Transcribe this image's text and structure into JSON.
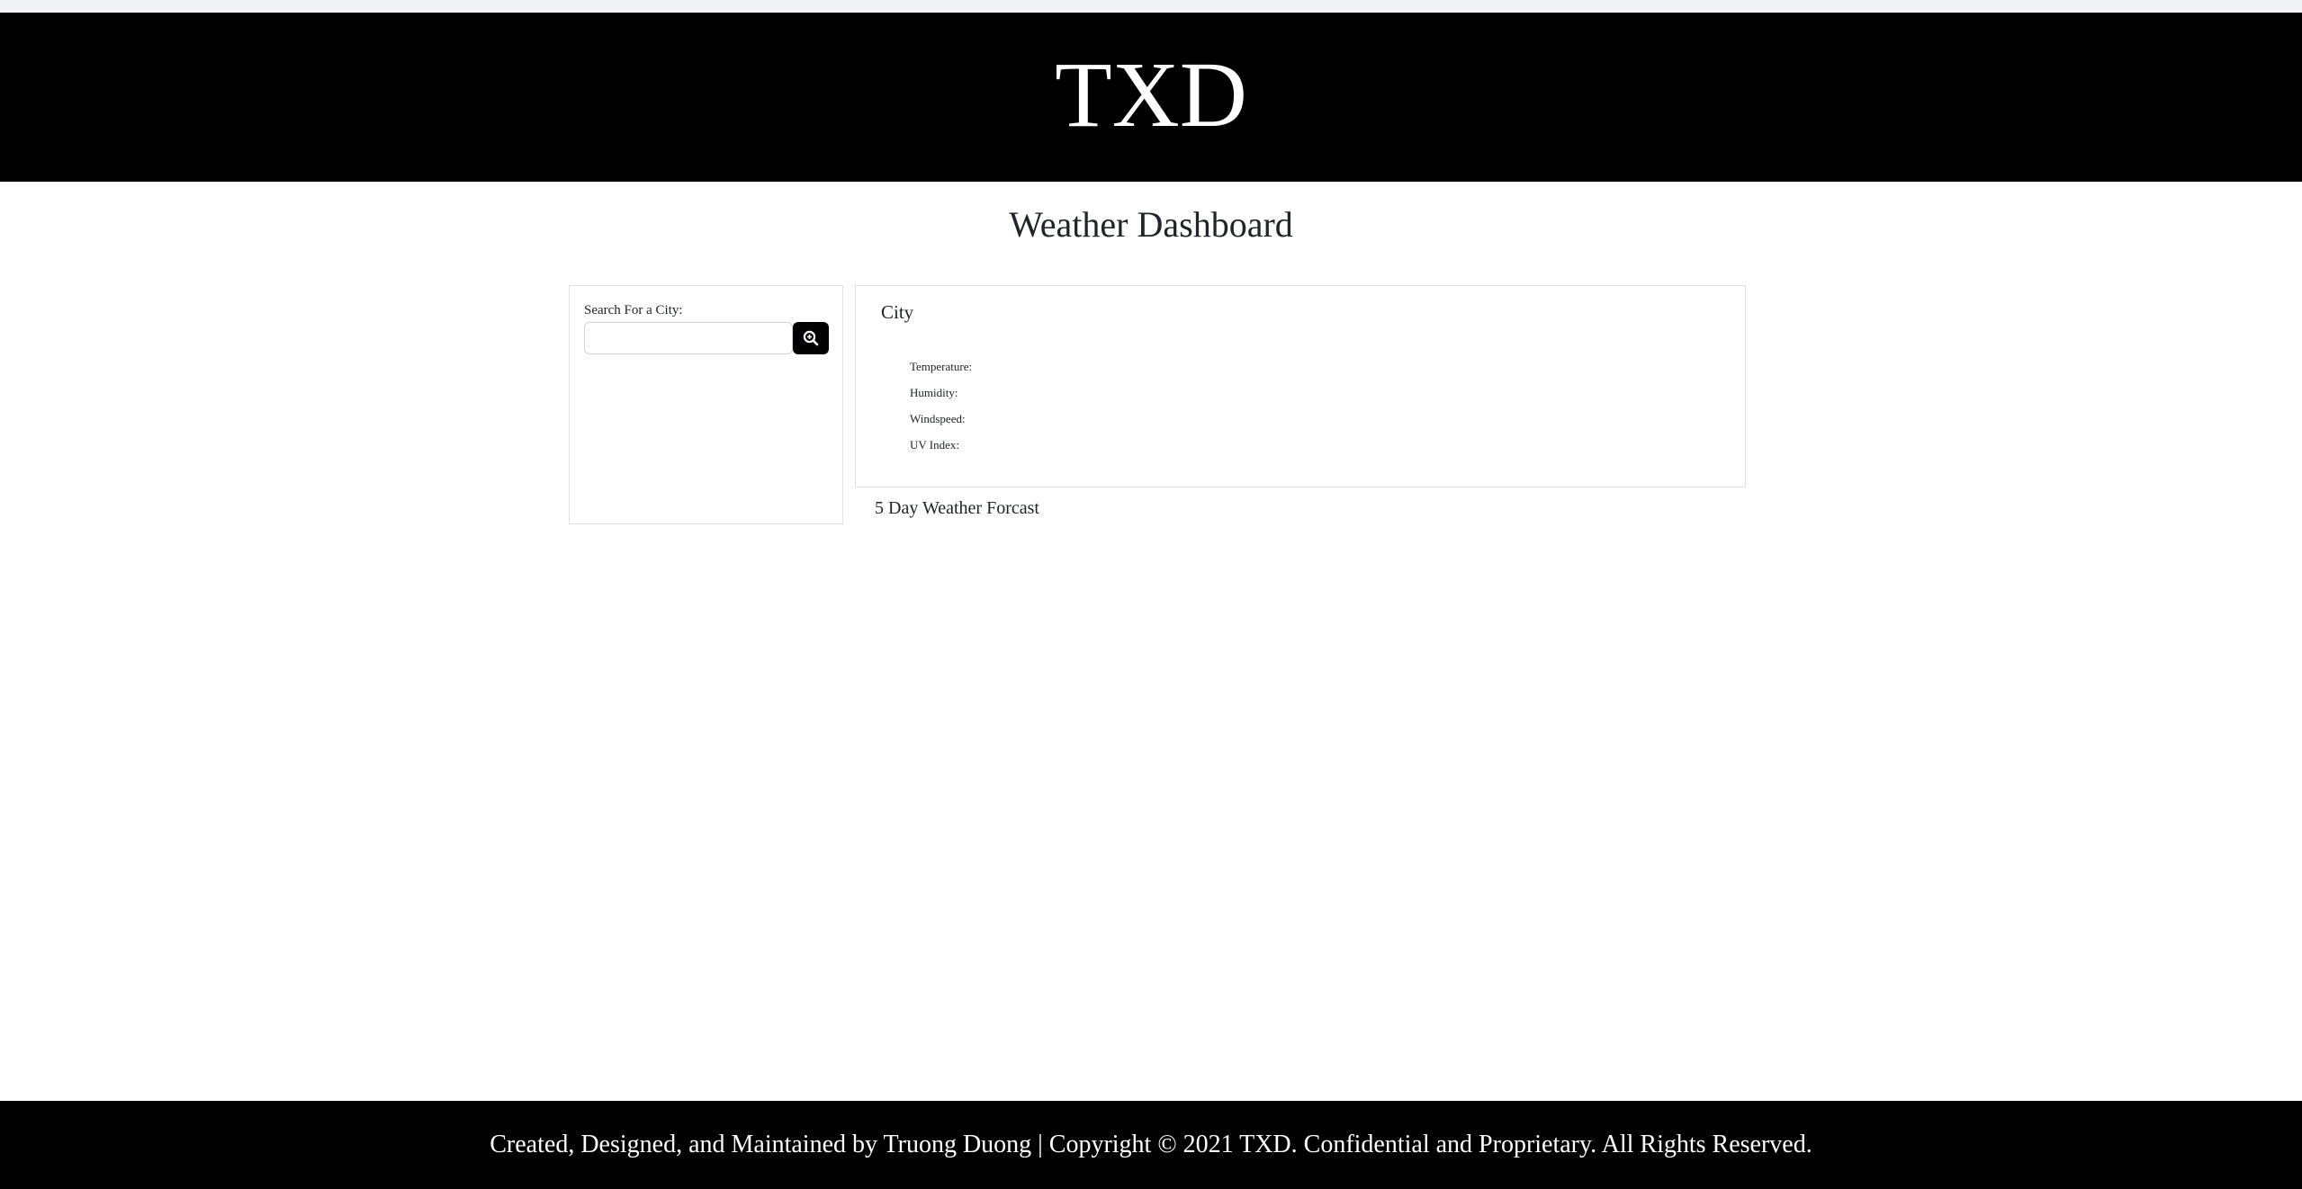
{
  "header": {
    "brand": "TXD"
  },
  "main": {
    "title": "Weather Dashboard"
  },
  "search": {
    "label": "Search For a City:",
    "value": "",
    "placeholder": "",
    "button_icon": "search-zoom-icon"
  },
  "current": {
    "city": "City",
    "stats": {
      "temperature_label": "Temperature:",
      "humidity_label": "Humidity:",
      "windspeed_label": "Windspeed:",
      "uv_label": "UV Index:"
    }
  },
  "forecast": {
    "heading": "5 Day Weather Forcast"
  },
  "footer": {
    "text": "Created, Designed, and Maintained by Truong Duong | Copyright © 2021 TXD. Confidential and Proprietary. All Rights Reserved."
  },
  "colors": {
    "header_bg": "#000000",
    "footer_bg": "#000000",
    "button_bg": "#000000",
    "card_border": "#dee2e6",
    "text": "#212529"
  }
}
